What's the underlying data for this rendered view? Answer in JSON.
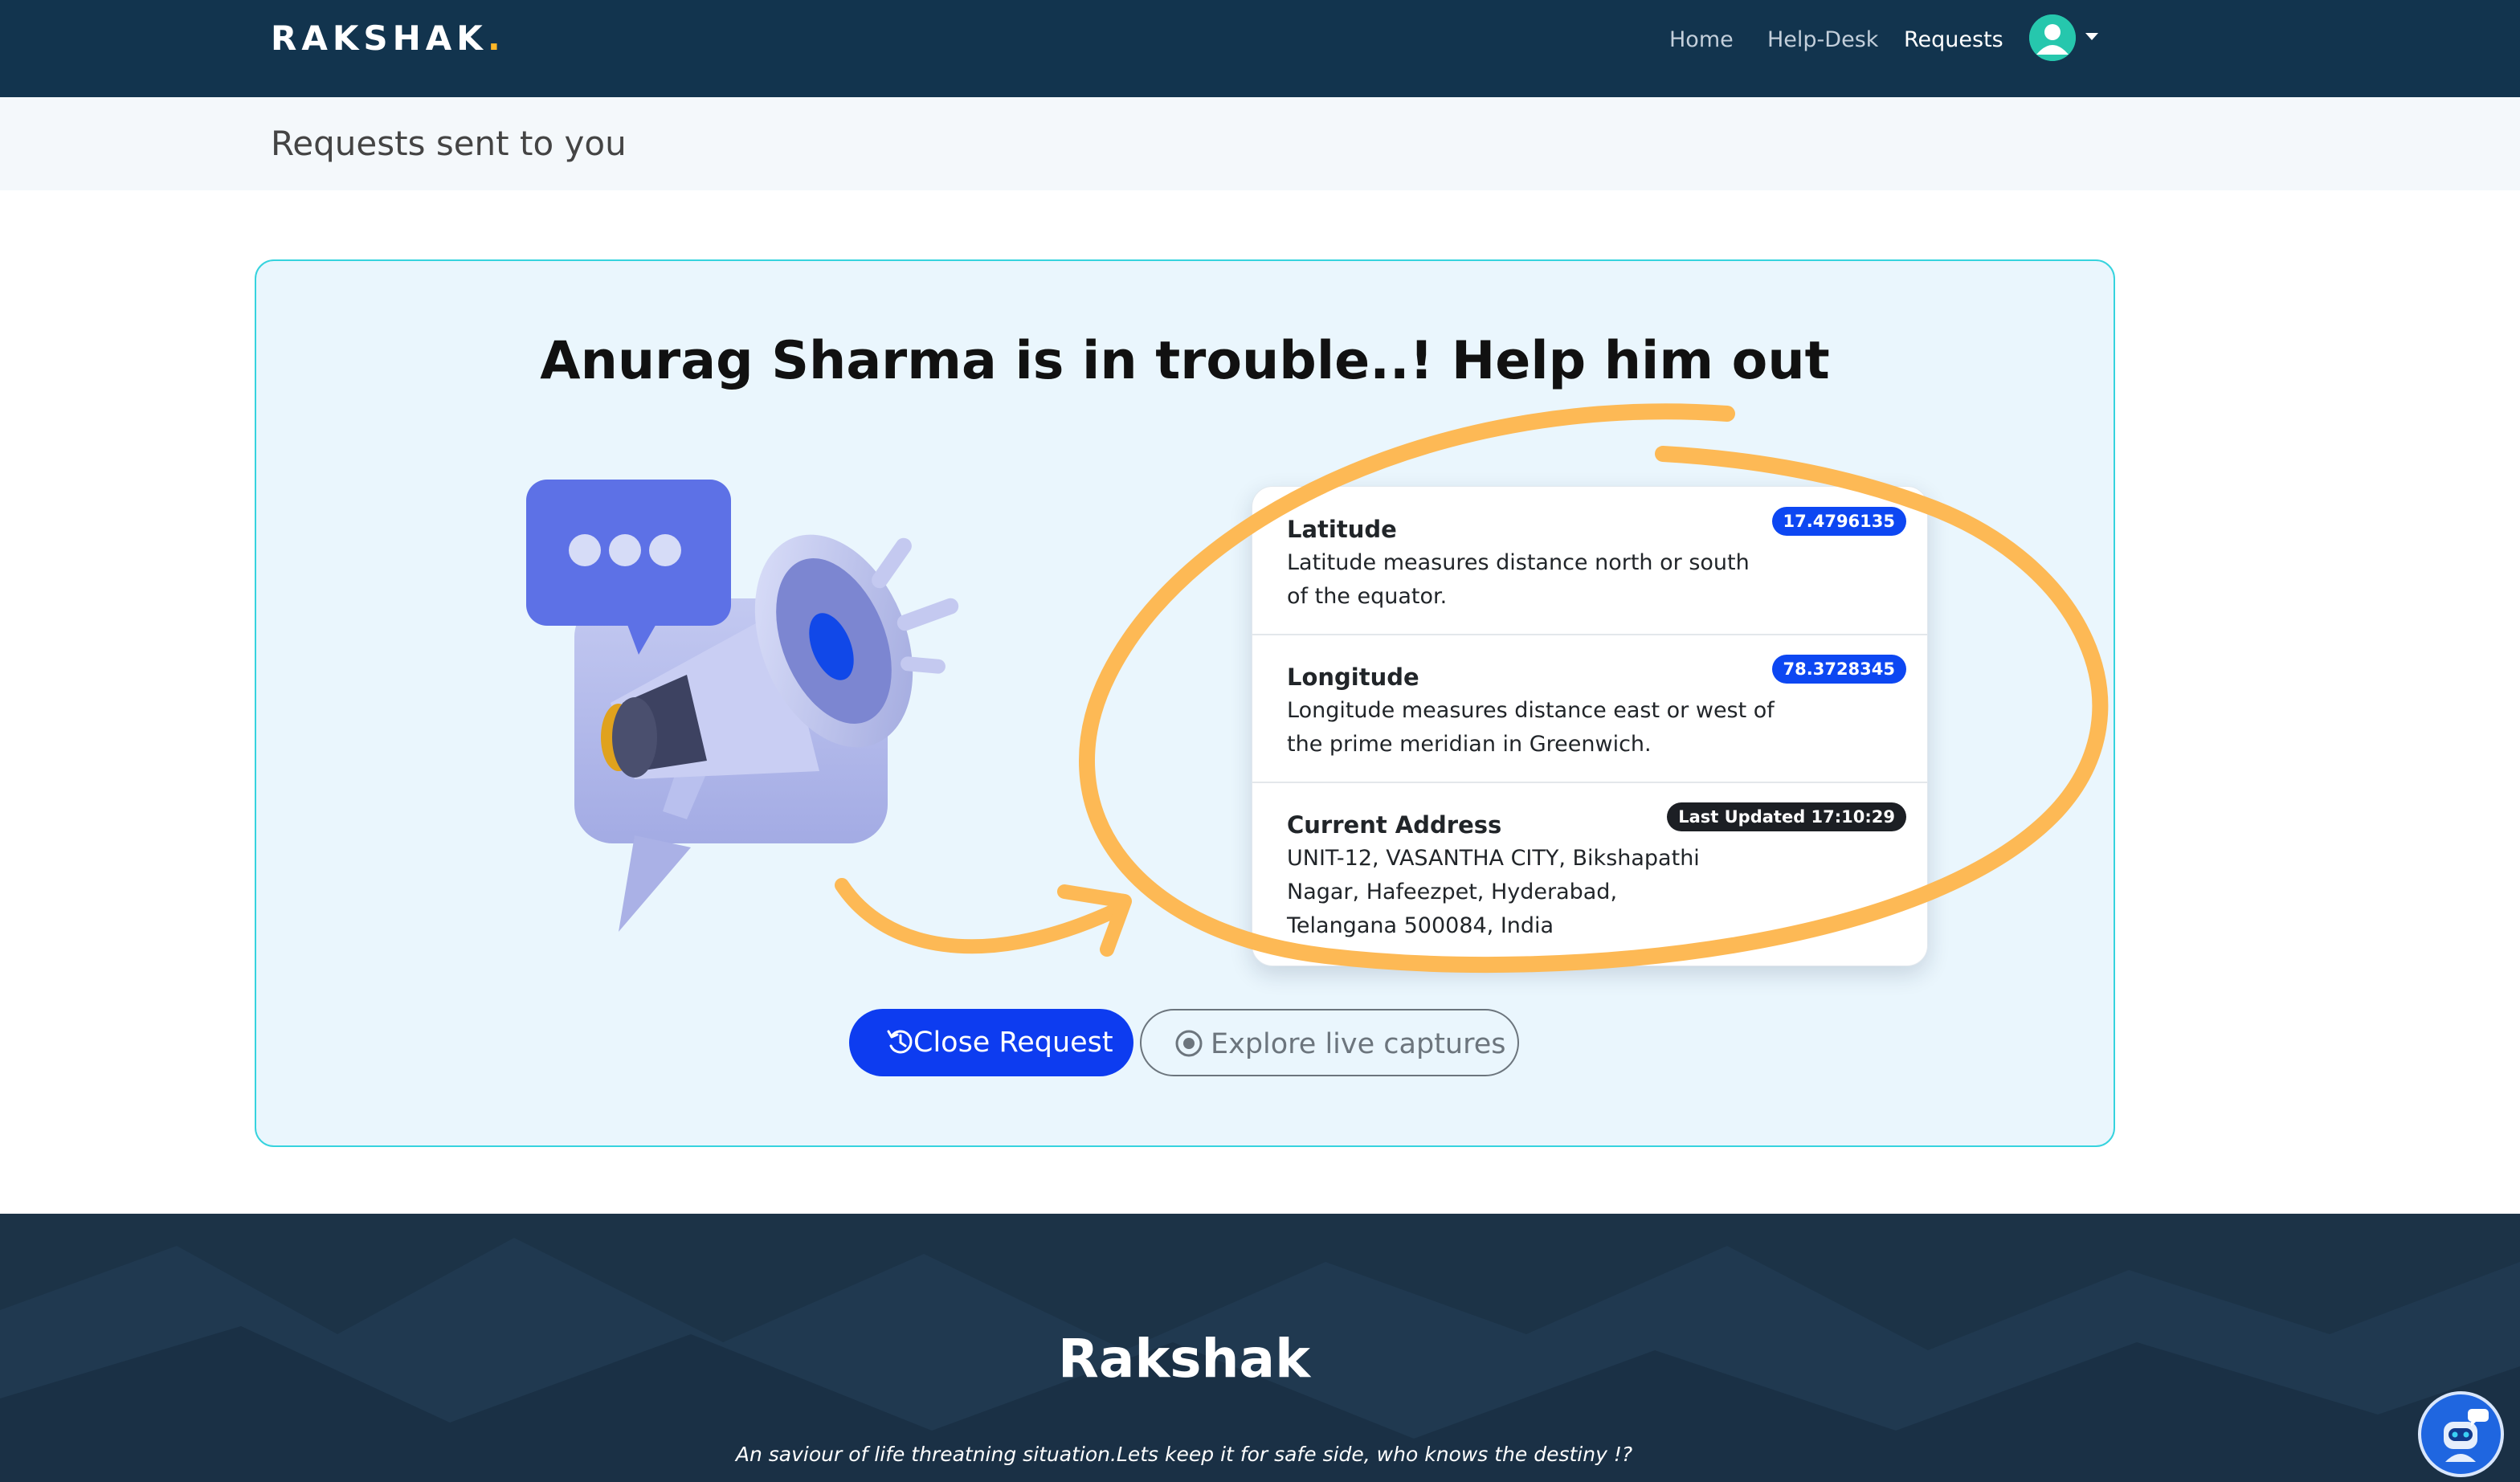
{
  "colors": {
    "navbar_bg": "#12344e",
    "brand_dot": "#ffb727",
    "card_bg": "#eaf6fd",
    "card_border": "#36d3de",
    "primary": "#0d3cf0",
    "badge_blue": "#0d47f2",
    "badge_dark": "#1c1f24",
    "annotation_orange": "#fdb955",
    "footer_bg": "#1c3347"
  },
  "navbar": {
    "brand": "RAKSHAK",
    "brand_dot": ".",
    "links": [
      {
        "label": "Home",
        "active": false
      },
      {
        "label": "Help-Desk",
        "active": false
      },
      {
        "label": "Requests",
        "active": true
      }
    ],
    "avatar_icon": "user-avatar-icon",
    "dropdown_icon": "caret-down-icon"
  },
  "page": {
    "title": "Requests sent to you"
  },
  "alert": {
    "person_name": "Anurag Sharma",
    "message": " is in trouble..! Help him out",
    "illustration_icon": "megaphone-chat-icon"
  },
  "info": {
    "items": [
      {
        "title": "Latitude",
        "description": "Latitude measures distance north or south of the equator.",
        "badge": "17.4796135"
      },
      {
        "title": "Longitude",
        "description": "Longitude measures distance east or west of the prime meridian in Greenwich.",
        "badge": "78.3728345"
      },
      {
        "title": "Current Address",
        "description": "UNIT-12, VASANTHA CITY, Bikshapathi Nagar, Hafeezpet, Hyderabad, Telangana 500084, India",
        "badge": "Last Updated 17:10:29"
      }
    ]
  },
  "actions": {
    "close_request": "Close Request",
    "close_request_icon": "history-icon",
    "explore": "Explore live captures",
    "explore_icon": "record-circle-icon"
  },
  "footer": {
    "title": "Rakshak",
    "tagline": "An saviour of life threatning situation.Lets keep it for safe side, who knows the destiny !?",
    "chatbot_icon": "chatbot-robot-icon"
  }
}
